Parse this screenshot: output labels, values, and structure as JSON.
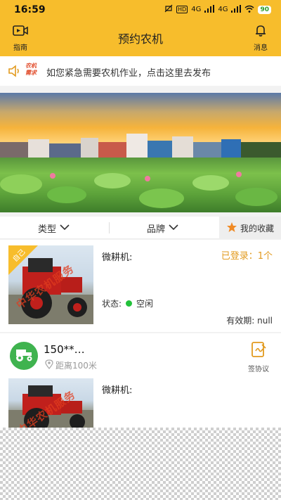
{
  "status_bar": {
    "time": "16:59",
    "net1": "4G",
    "net2": "4G",
    "battery": "90"
  },
  "nav": {
    "title": "预约农机",
    "left_label": "指南",
    "right_label": "消息"
  },
  "notice": {
    "tag_line1": "农机",
    "tag_line2": "需求",
    "text": "如您紧急需要农机作业，点击这里去发布"
  },
  "filters": {
    "type_label": "类型",
    "brand_label": "品牌",
    "favorites_label": "我的收藏"
  },
  "listings": [
    {
      "self_tag": "自己",
      "name": "微耕机:",
      "login_status": "已登录：1个",
      "state_label": "状态:",
      "state_value": "空闲",
      "validity_label": "有效期:",
      "validity_value": "null",
      "watermark": "中华农机服务"
    },
    {
      "user": "150**…",
      "distance": "距离100米",
      "sign_label": "签协议",
      "name": "微耕机:",
      "watermark": "中华农机服务"
    }
  ],
  "colors": {
    "header": "#f7bd2c",
    "accent_orange": "#e29a1e",
    "status_green": "#22c13a",
    "avatar_green": "#3fb34f"
  }
}
